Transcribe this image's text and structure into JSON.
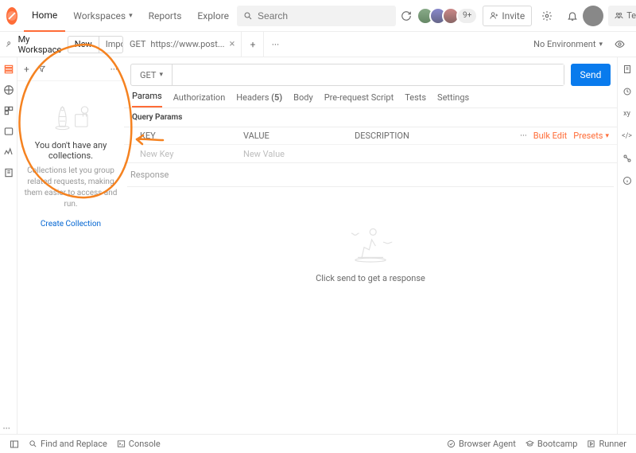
{
  "nav": {
    "home": "Home",
    "workspaces": "Workspaces",
    "reports": "Reports",
    "explore": "Explore",
    "search_placeholder": "Search"
  },
  "topright": {
    "extra": "9+",
    "invite": "Invite",
    "team": "Team"
  },
  "workspace": {
    "name": "My Workspace",
    "new": "New",
    "import": "Import"
  },
  "reqtab": {
    "method": "GET",
    "title": "https://www.post..."
  },
  "env": {
    "label": "No Environment"
  },
  "sidebar": {
    "title": "You don't have any collections.",
    "desc": "Collections let you group related requests, making them easier to access and run.",
    "link": "Create Collection"
  },
  "request": {
    "method": "GET",
    "url": "",
    "send": "Send",
    "tabs": {
      "params": "Params",
      "auth": "Authorization",
      "headers": "Headers",
      "headers_badge": "(5)",
      "body": "Body",
      "prescript": "Pre-request Script",
      "tests": "Tests",
      "settings": "Settings"
    },
    "qp_title": "Query Params",
    "columns": {
      "key": "KEY",
      "value": "VALUE",
      "desc": "DESCRIPTION"
    },
    "placeholder": {
      "key": "New Key",
      "value": "New Value"
    },
    "bulk": "Bulk Edit",
    "presets": "Presets"
  },
  "response": {
    "label": "Response",
    "hint": "Click send to get a response"
  },
  "right_rail": {
    "xy": "xy",
    "code": "</>"
  },
  "status": {
    "find": "Find and Replace",
    "console": "Console",
    "agent": "Browser Agent",
    "bootcamp": "Bootcamp",
    "runner": "Runner"
  }
}
